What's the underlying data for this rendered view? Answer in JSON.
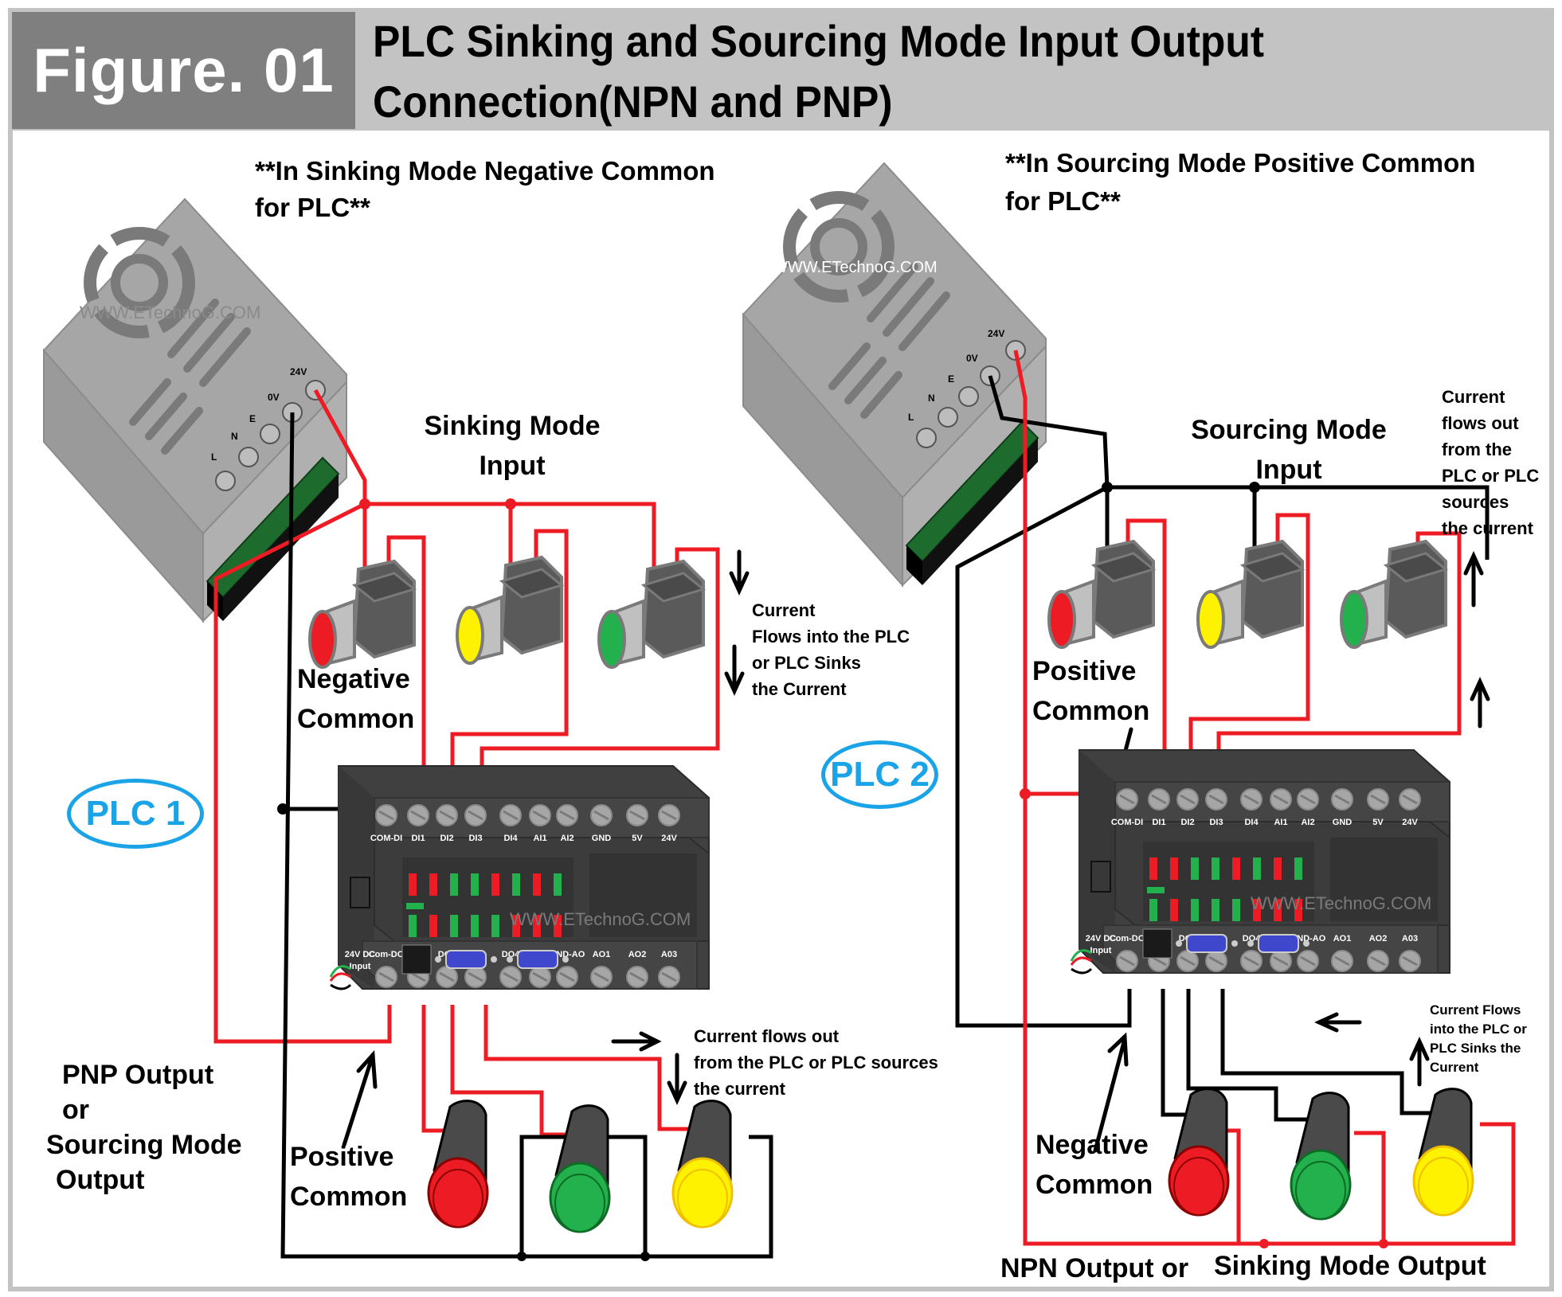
{
  "header": {
    "figure_label": "Figure. 01",
    "title_line1": "PLC Sinking and Sourcing Mode Input Output",
    "title_line2": "Connection(NPN and PNP)"
  },
  "colors": {
    "wire_positive": "#ed1c24",
    "wire_negative": "#000000",
    "plc_label": "#1aa3e6",
    "plc_body": "#404040",
    "terminal_block": "#1e6b2e",
    "psu_body": "#a6a6a6",
    "frame": "#c3c3c3",
    "figure_box": "#7f7f7f"
  },
  "left": {
    "note_line1": "**In Sinking Mode Negative Common",
    "note_line2": "for PLC**",
    "psu": {
      "watermark": "WWW.ETechnoG.COM",
      "terminals": [
        "L",
        "N",
        "E",
        "0V",
        "24V"
      ]
    },
    "input_title_line1": "Sinking Mode",
    "input_title_line2": "Input",
    "sensors": [
      {
        "name": "sensor-red",
        "lens_color": "#ed1c24"
      },
      {
        "name": "sensor-yellow",
        "lens_color": "#fff200"
      },
      {
        "name": "sensor-green",
        "lens_color": "#22b14c"
      }
    ],
    "common_in_line1": "Negative",
    "common_in_line2": "Common",
    "current_in_lines": [
      "Current",
      "Flows into the PLC",
      "or PLC Sinks",
      "the Current"
    ],
    "plc_label": "PLC 1",
    "output_type_lines": [
      "PNP Output",
      "or",
      "Sourcing Mode",
      "Output"
    ],
    "common_out_line1": "Positive",
    "common_out_line2": "Common",
    "current_out_lines": [
      "Current flows out",
      "from the PLC or PLC sources",
      "the current"
    ],
    "lamps": [
      {
        "name": "lamp-red",
        "color": "#ed1c24"
      },
      {
        "name": "lamp-green",
        "color": "#22b14c"
      },
      {
        "name": "lamp-yellow",
        "color": "#fff200"
      }
    ]
  },
  "right": {
    "note_line1": "**In Sourcing Mode Positive Common",
    "note_line2": "for PLC**",
    "psu": {
      "watermark": "WWW.ETechnoG.COM",
      "terminals": [
        "L",
        "N",
        "E",
        "0V",
        "24V"
      ]
    },
    "input_title_line1": "Sourcing Mode",
    "input_title_line2": "Input",
    "current_out_lines": [
      "Current",
      "flows out",
      "from the",
      "PLC or PLC",
      "sources",
      "the current"
    ],
    "common_in_line1": "Positive",
    "common_in_line2": "Common",
    "plc_label": "PLC 2",
    "current_in_lines": [
      "Current Flows",
      "into the PLC or",
      "PLC Sinks the",
      "Current"
    ],
    "common_out_line1": "Negative",
    "common_out_line2": "Common",
    "output_type_part1": "NPN Output or",
    "output_type_part2": "Sinking Mode Output"
  },
  "plc": {
    "top_terminals": [
      "COM-DI",
      "DI1",
      "DI2",
      "DI3",
      "DI4",
      "AI1",
      "AI2",
      "GND",
      "5V",
      "24V"
    ],
    "bottom_terminals": [
      "Com-DO",
      "DO1",
      "DO2",
      "DO3",
      "DO4",
      "DO5",
      "GND-AO",
      "AO1",
      "AO2",
      "A03"
    ],
    "power_label_line1": "24V DC",
    "power_label_line2": "Input",
    "watermark": "WWW.ETechnoG.COM",
    "led_top_row": [
      "red",
      "red",
      "green",
      "green",
      "red",
      "green",
      "red",
      "green"
    ],
    "led_bottom_row": [
      "green",
      "red",
      "green",
      "green",
      "green",
      "red",
      "red",
      "red"
    ]
  }
}
